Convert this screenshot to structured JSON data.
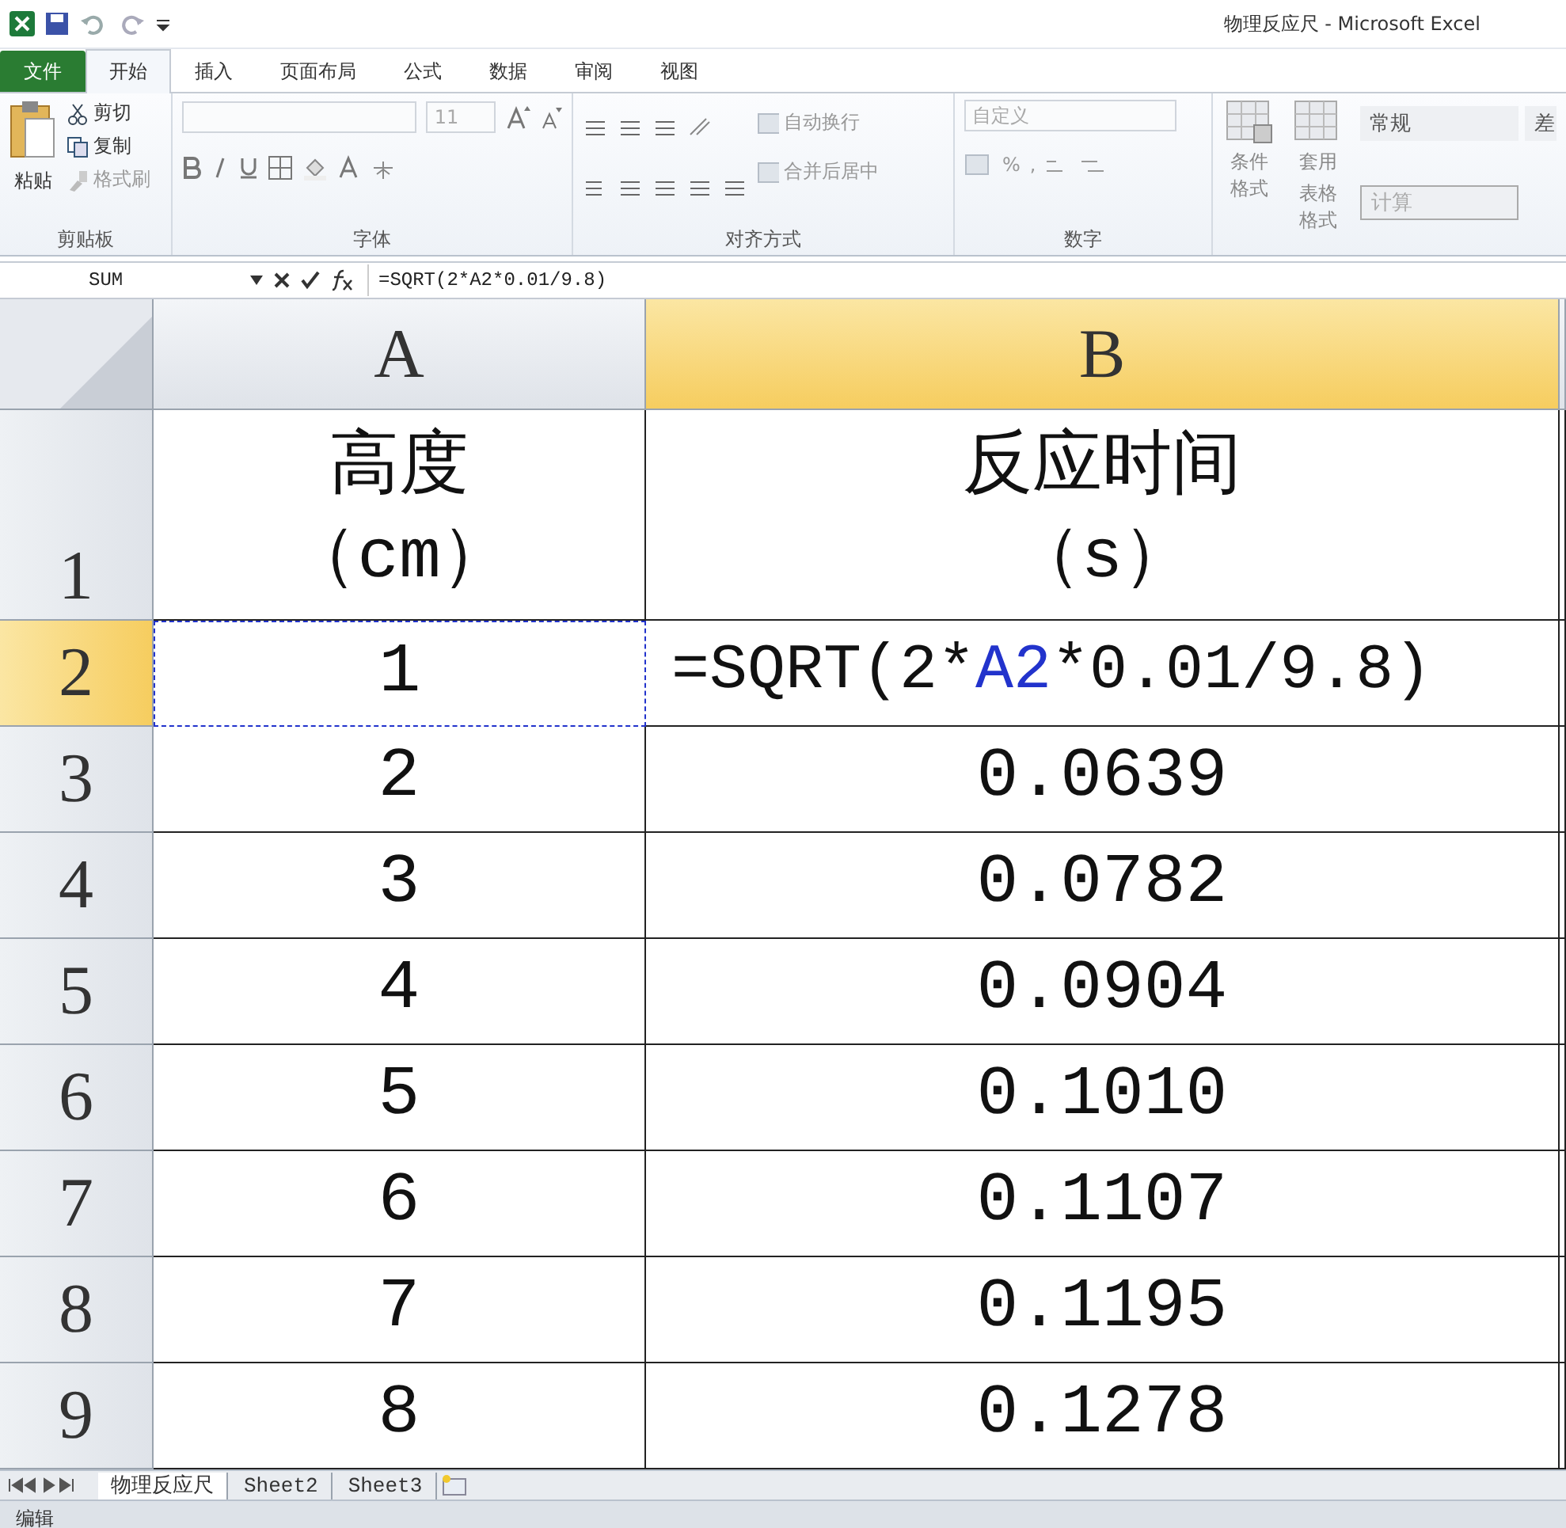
{
  "window": {
    "title": "物理反应尺 - Microsoft Excel"
  },
  "tabs": [
    {
      "label": "文件",
      "kind": "file",
      "selected": false
    },
    {
      "label": "开始",
      "kind": "tab",
      "selected": true
    },
    {
      "label": "插入",
      "kind": "tab",
      "selected": false
    },
    {
      "label": "页面布局",
      "kind": "tab",
      "selected": false
    },
    {
      "label": "公式",
      "kind": "tab",
      "selected": false
    },
    {
      "label": "数据",
      "kind": "tab",
      "selected": false
    },
    {
      "label": "审阅",
      "kind": "tab",
      "selected": false
    },
    {
      "label": "视图",
      "kind": "tab",
      "selected": false
    }
  ],
  "ribbon": {
    "clipboard": {
      "label": "剪贴板",
      "paste": "粘贴",
      "cut": "剪切",
      "copy": "复制",
      "format_painter": "格式刷"
    },
    "font": {
      "label": "字体",
      "size": "11"
    },
    "alignment": {
      "label": "对齐方式",
      "wrap": "自动换行",
      "merge": "合并后居中"
    },
    "number": {
      "label": "数字",
      "format": "自定义",
      "percent": "%",
      "comma": ","
    },
    "styles": {
      "conditional": "条件格式",
      "table_format": [
        "套用",
        "表格格式"
      ],
      "cells": [
        "常规",
        "差",
        "计算"
      ]
    }
  },
  "formula_bar": {
    "name_box": "SUM",
    "formula": "=SQRT(2*A2*0.01/9.8)"
  },
  "columns": [
    {
      "label": "A",
      "selected": false
    },
    {
      "label": "B",
      "selected": true
    }
  ],
  "rows": [
    {
      "header": "1",
      "selected": false,
      "cells": [
        {
          "lines": [
            "高度",
            "（cm）"
          ]
        },
        {
          "lines": [
            "反应时间",
            "（s）"
          ]
        }
      ]
    },
    {
      "header": "2",
      "selected": true,
      "cells": [
        {
          "lines": [
            "1"
          ],
          "referenced": true
        },
        {
          "kind": "formula",
          "parts": [
            {
              "text": "=SQRT(2*"
            },
            {
              "text": "A2",
              "kind": "reference"
            },
            {
              "text": "*0.01/9.8)"
            }
          ]
        }
      ]
    },
    {
      "header": "3",
      "selected": false,
      "cells": [
        {
          "lines": [
            "2"
          ]
        },
        {
          "lines": [
            "0.0639"
          ]
        }
      ]
    },
    {
      "header": "4",
      "selected": false,
      "cells": [
        {
          "lines": [
            "3"
          ]
        },
        {
          "lines": [
            "0.0782"
          ]
        }
      ]
    },
    {
      "header": "5",
      "selected": false,
      "cells": [
        {
          "lines": [
            "4"
          ]
        },
        {
          "lines": [
            "0.0904"
          ]
        }
      ]
    },
    {
      "header": "6",
      "selected": false,
      "cells": [
        {
          "lines": [
            "5"
          ]
        },
        {
          "lines": [
            "0.1010"
          ]
        }
      ]
    },
    {
      "header": "7",
      "selected": false,
      "cells": [
        {
          "lines": [
            "6"
          ]
        },
        {
          "lines": [
            "0.1107"
          ]
        }
      ]
    },
    {
      "header": "8",
      "selected": false,
      "cells": [
        {
          "lines": [
            "7"
          ]
        },
        {
          "lines": [
            "0.1195"
          ]
        }
      ]
    },
    {
      "header": "9",
      "selected": false,
      "cells": [
        {
          "lines": [
            "8"
          ]
        },
        {
          "lines": [
            "0.1278"
          ]
        }
      ]
    }
  ],
  "sheets": [
    {
      "label": "物理反应尺",
      "selected": true
    },
    {
      "label": "Sheet2",
      "selected": false
    },
    {
      "label": "Sheet3",
      "selected": false
    }
  ],
  "status_bar": {
    "mode": "编辑"
  }
}
